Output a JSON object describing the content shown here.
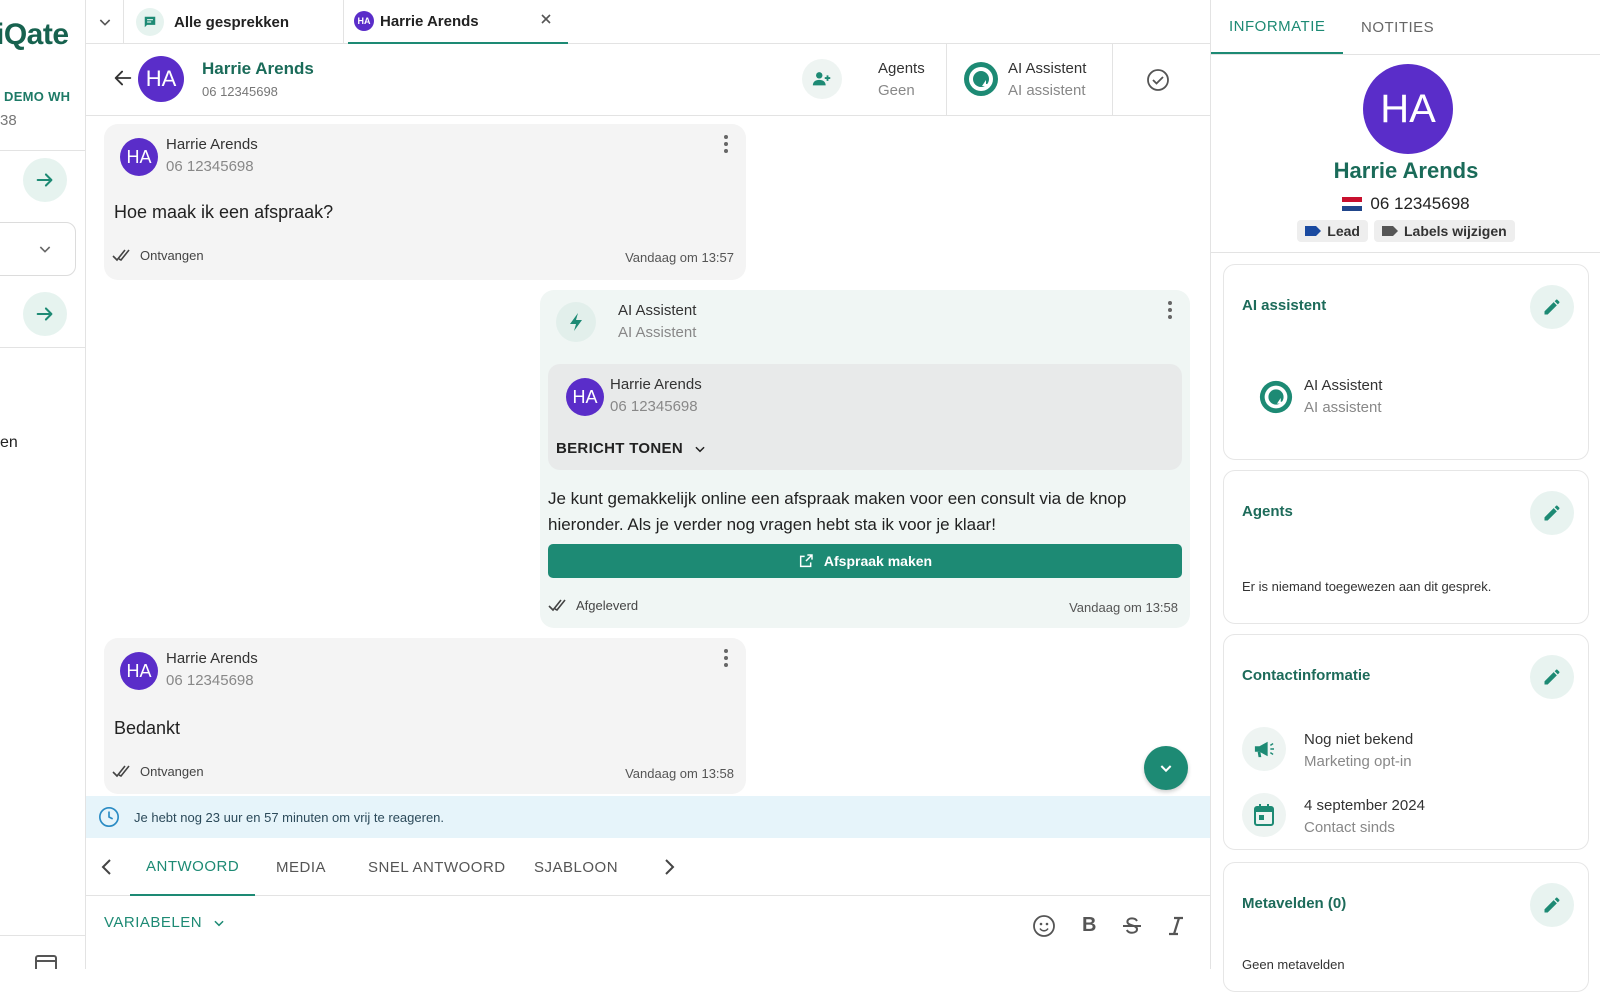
{
  "sidebar": {
    "brand": "iQate",
    "workspace": "DEMO WH",
    "workspace_num": "38",
    "partial_text": "en"
  },
  "tabs": {
    "all_label": "Alle gesprekken",
    "active_label": "Harrie Arends",
    "active_initials": "HA"
  },
  "header": {
    "initials": "HA",
    "name": "Harrie Arends",
    "phone": "06 12345698",
    "agents_label": "Agents",
    "agents_value": "Geen",
    "ai_label": "AI Assistent",
    "ai_value": "AI assistent"
  },
  "messages": [
    {
      "initials": "HA",
      "name": "Harrie Arends",
      "phone": "06 12345698",
      "text": "Hoe maak ik een afspraak?",
      "status": "Ontvangen",
      "time": "Vandaag om 13:57"
    },
    {
      "sender": "AI Assistent",
      "sender_sub": "AI Assistent",
      "quoted_initials": "HA",
      "quoted_name": "Harrie Arends",
      "quoted_phone": "06 12345698",
      "show_message_label": "BERICHT TONEN",
      "text": "Je kunt gemakkelijk online een afspraak maken voor een consult via de knop hieronder. Als je verder nog vragen hebt sta ik voor je klaar!",
      "button_label": "Afspraak maken",
      "status": "Afgeleverd",
      "time": "Vandaag om 13:58"
    },
    {
      "initials": "HA",
      "name": "Harrie Arends",
      "phone": "06 12345698",
      "text": "Bedankt",
      "status": "Ontvangen",
      "time": "Vandaag om 13:58"
    }
  ],
  "banner": {
    "text": "Je hebt nog 23 uur en 57 minuten om vrij te reageren."
  },
  "composer": {
    "tabs": [
      "ANTWOORD",
      "MEDIA",
      "SNEL ANTWOORD",
      "SJABLOON"
    ],
    "variables_label": "VARIABELEN",
    "bold_label": "B"
  },
  "panel": {
    "tab_info": "INFORMATIE",
    "tab_notes": "NOTITIES",
    "initials": "HA",
    "name": "Harrie Arends",
    "phone": "06 12345698",
    "label_lead": "Lead",
    "label_edit": "Labels wijzigen",
    "ai_card": {
      "title": "AI assistent",
      "name": "AI Assistent",
      "sub": "AI assistent"
    },
    "agents_card": {
      "title": "Agents",
      "empty": "Er is niemand toegewezen aan dit gesprek."
    },
    "contact_card": {
      "title": "Contactinformatie",
      "marketing_value": "Nog niet bekend",
      "marketing_label": "Marketing opt-in",
      "since_value": "4 september 2024",
      "since_label": "Contact sinds"
    },
    "meta_card": {
      "title": "Metavelden (0)",
      "empty": "Geen metavelden"
    }
  },
  "colors": {
    "accent": "#1d8a74",
    "avatar": "#5a2dc9",
    "banner_bg": "#e6f4fa",
    "button": "#1d8a74"
  }
}
